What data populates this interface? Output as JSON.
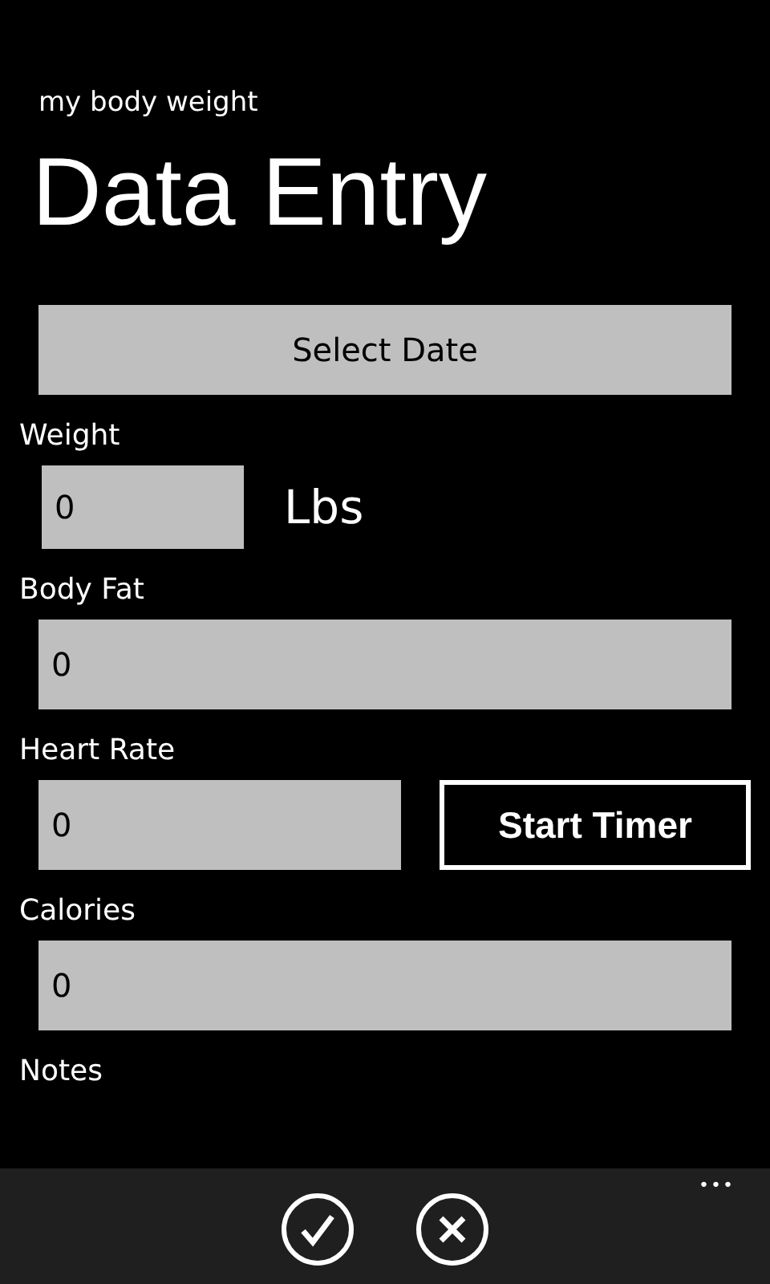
{
  "app_title": "my body weight",
  "page_title": "Data Entry",
  "select_date_button": "Select Date",
  "fields": [
    {
      "kind": "unit",
      "label": "Weight",
      "value": "0",
      "unit": "Lbs"
    },
    {
      "kind": "full",
      "label": "Body Fat",
      "value": "0"
    },
    {
      "kind": "button",
      "label": "Heart Rate",
      "value": "0",
      "button": "Start Timer"
    },
    {
      "kind": "full",
      "label": "Calories",
      "value": "0"
    },
    {
      "kind": "label",
      "label": "Notes"
    }
  ],
  "app_bar": {
    "buttons": [
      {
        "kind": "check"
      },
      {
        "kind": "cancel"
      }
    ],
    "more": "•••"
  }
}
